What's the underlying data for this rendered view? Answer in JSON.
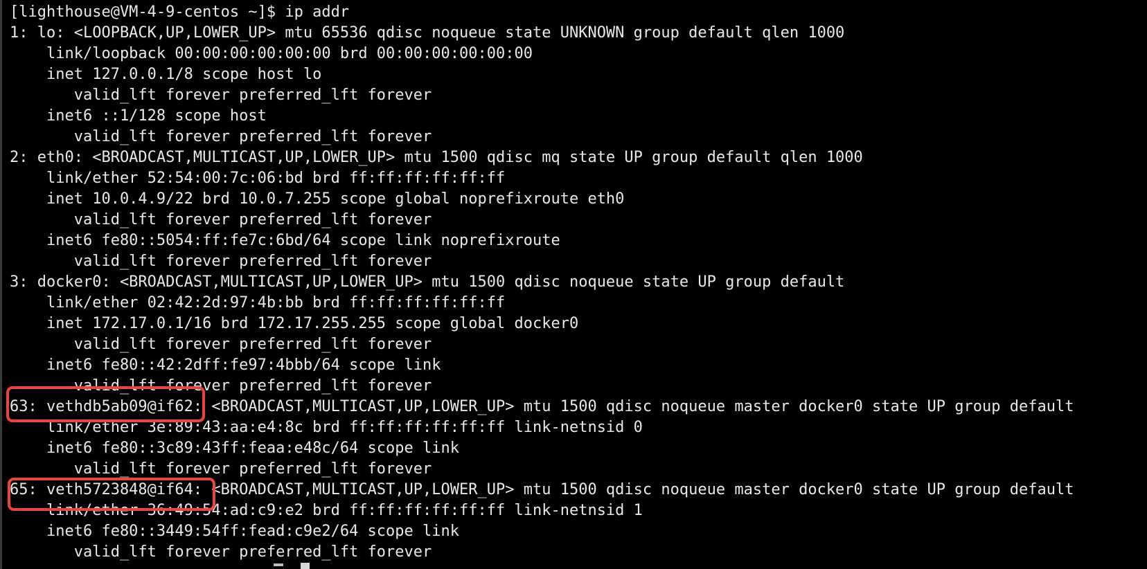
{
  "terminal": {
    "lines": [
      "[lighthouse@VM-4-9-centos ~]$ ip addr",
      "1: lo: <LOOPBACK,UP,LOWER_UP> mtu 65536 qdisc noqueue state UNKNOWN group default qlen 1000",
      "    link/loopback 00:00:00:00:00:00 brd 00:00:00:00:00:00",
      "    inet 127.0.0.1/8 scope host lo",
      "       valid_lft forever preferred_lft forever",
      "    inet6 ::1/128 scope host",
      "       valid_lft forever preferred_lft forever",
      "2: eth0: <BROADCAST,MULTICAST,UP,LOWER_UP> mtu 1500 qdisc mq state UP group default qlen 1000",
      "    link/ether 52:54:00:7c:06:bd brd ff:ff:ff:ff:ff:ff",
      "    inet 10.0.4.9/22 brd 10.0.7.255 scope global noprefixroute eth0",
      "       valid_lft forever preferred_lft forever",
      "    inet6 fe80::5054:ff:fe7c:6bd/64 scope link noprefixroute",
      "       valid_lft forever preferred_lft forever",
      "3: docker0: <BROADCAST,MULTICAST,UP,LOWER_UP> mtu 1500 qdisc noqueue state UP group default",
      "    link/ether 02:42:2d:97:4b:bb brd ff:ff:ff:ff:ff:ff",
      "    inet 172.17.0.1/16 brd 172.17.255.255 scope global docker0",
      "       valid_lft forever preferred_lft forever",
      "    inet6 fe80::42:2dff:fe97:4bbb/64 scope link",
      "       valid_lft forever preferred_lft forever",
      "63: vethdb5ab09@if62: <BROADCAST,MULTICAST,UP,LOWER_UP> mtu 1500 qdisc noqueue master docker0 state UP group default",
      "    link/ether 3e:89:43:aa:e4:8c brd ff:ff:ff:ff:ff:ff link-netnsid 0",
      "    inet6 fe80::3c89:43ff:feaa:e48c/64 scope link",
      "       valid_lft forever preferred_lft forever",
      "65: veth5723848@if64: <BROADCAST,MULTICAST,UP,LOWER_UP> mtu 1500 qdisc noqueue master docker0 state UP group default",
      "    link/ether 36:49:54:ad:c9:e2 brd ff:ff:ff:ff:ff:ff link-netnsid 1",
      "    inet6 fe80::3449:54ff:fead:c9e2/64 scope link",
      "       valid_lft forever preferred_lft forever"
    ]
  },
  "highlights": {
    "color": "#e8453c",
    "labels": [
      "63: vethdb5ab09@if62",
      "65: veth5723848@if64:"
    ]
  }
}
